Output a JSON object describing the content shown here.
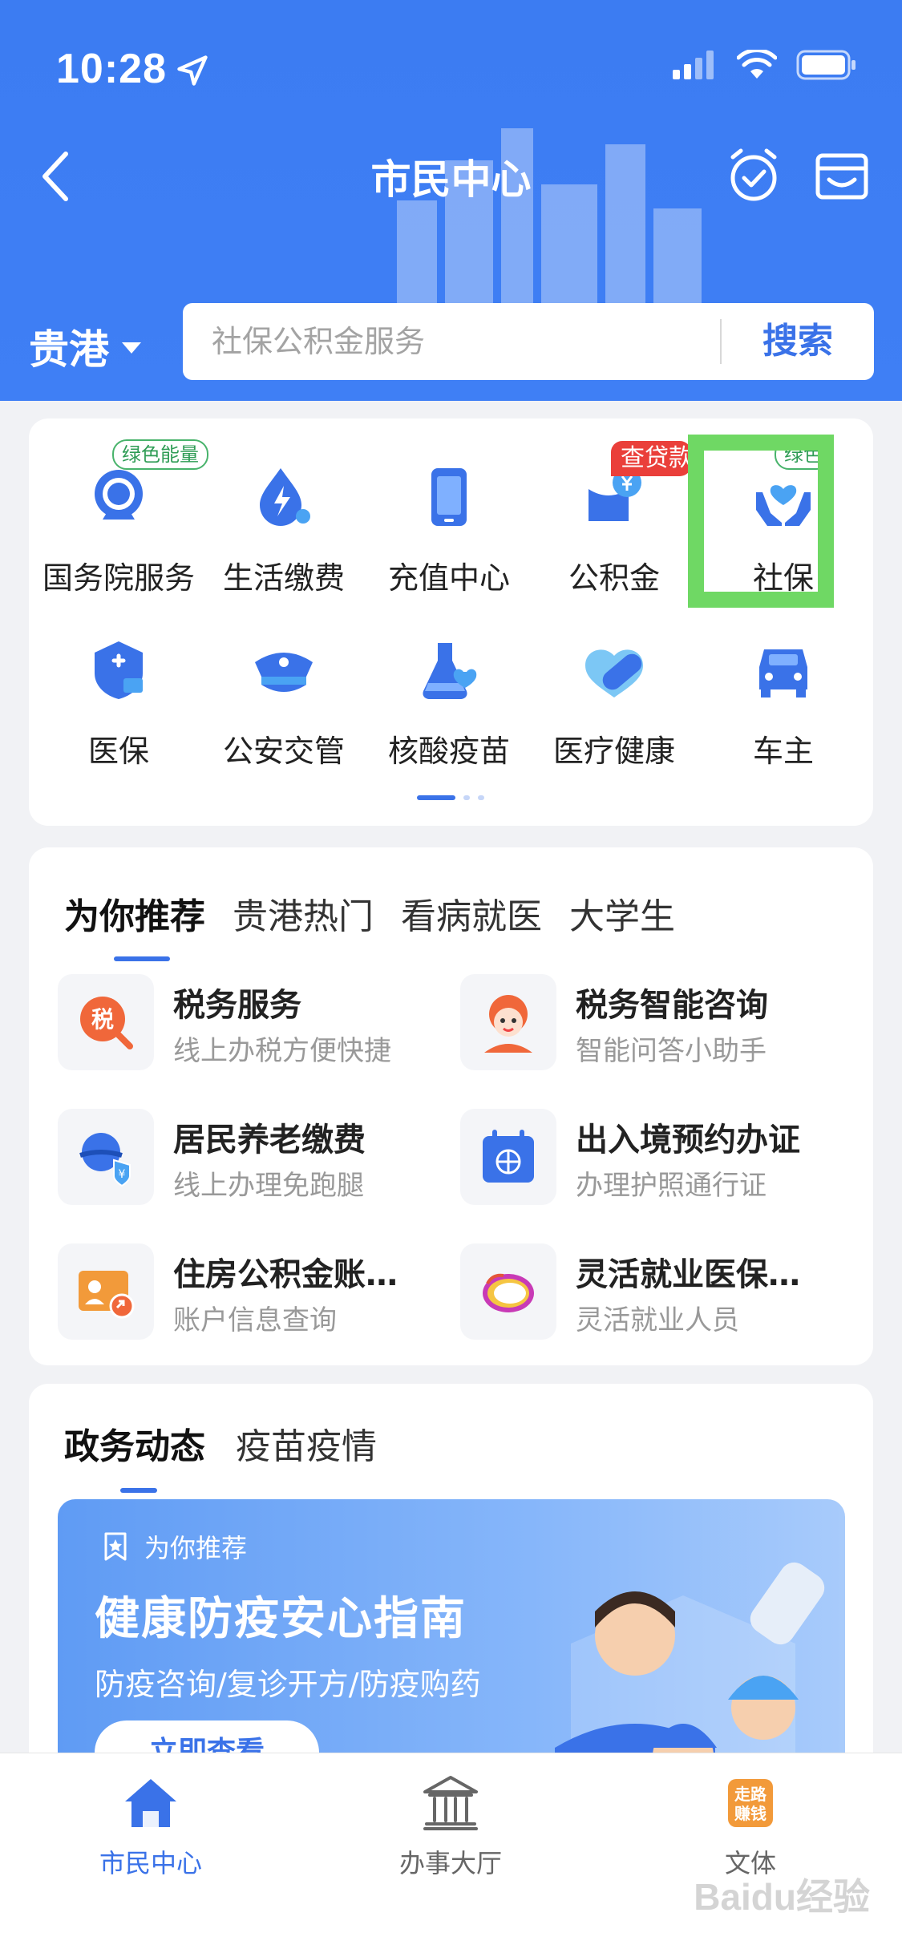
{
  "status_bar": {
    "time": "10:28"
  },
  "nav": {
    "title": "市民中心"
  },
  "search": {
    "city": "贵港",
    "placeholder": "社保公积金服务",
    "button_label": "搜索"
  },
  "grid": {
    "items": [
      {
        "label": "国务院服务",
        "icon": "state-council-icon",
        "badge": "绿色能量"
      },
      {
        "label": "生活缴费",
        "icon": "lightning-drop-icon"
      },
      {
        "label": "充值中心",
        "icon": "phone-icon"
      },
      {
        "label": "公积金",
        "icon": "fund-icon",
        "badge": "查贷款"
      },
      {
        "label": "社保",
        "icon": "social-security-icon",
        "badge": "绿色能"
      },
      {
        "label": "医保",
        "icon": "medical-insurance-icon"
      },
      {
        "label": "公安交管",
        "icon": "police-cap-icon"
      },
      {
        "label": "核酸疫苗",
        "icon": "flask-icon"
      },
      {
        "label": "医疗健康",
        "icon": "health-capsule-icon"
      },
      {
        "label": "车主",
        "icon": "car-icon"
      }
    ]
  },
  "recommend": {
    "tabs": [
      "为你推荐",
      "贵港热门",
      "看病就医",
      "大学生"
    ],
    "services": [
      {
        "title": "税务服务",
        "subtitle": "线上办税方便快捷",
        "icon": "tax-icon"
      },
      {
        "title": "税务智能咨询",
        "subtitle": "智能问答小助手",
        "icon": "assistant-icon"
      },
      {
        "title": "居民养老缴费",
        "subtitle": "线上办理免跑腿",
        "icon": "pension-icon"
      },
      {
        "title": "出入境预约办证",
        "subtitle": "办理护照通行证",
        "icon": "passport-calendar-icon"
      },
      {
        "title": "住房公积金账…",
        "subtitle": "账户信息查询",
        "icon": "housing-fund-card-icon"
      },
      {
        "title": "灵活就业医保…",
        "subtitle": "灵活就业人员",
        "icon": "flexible-employment-icon"
      }
    ]
  },
  "news": {
    "tabs": [
      "政务动态",
      "疫苗疫情"
    ],
    "banner": {
      "tag": "为你推荐",
      "title": "健康防疫安心指南",
      "subtitle": "防疫咨询/复诊开方/防疫购药",
      "cta": "立即查看"
    }
  },
  "tabbar": {
    "items": [
      {
        "label": "市民中心",
        "icon": "home-icon",
        "active": true
      },
      {
        "label": "办事大厅",
        "icon": "hall-icon",
        "active": false
      },
      {
        "label": "文体",
        "icon": "sports-culture-icon",
        "active": false
      }
    ]
  },
  "watermark": "Baidu经验",
  "colors": {
    "primary": "#3a72e8",
    "header": "#3f7ff5",
    "highlight": "#6fd864",
    "badge_red": "#ea3f3a"
  }
}
